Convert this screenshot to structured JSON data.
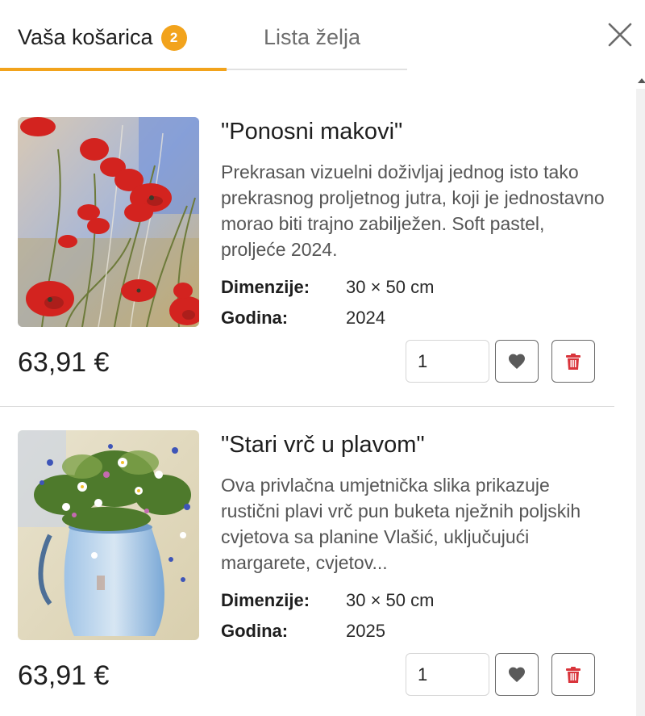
{
  "tabs": {
    "cart_label": "Vaša košarica",
    "cart_count": "2",
    "wishlist_label": "Lista želja"
  },
  "colors": {
    "accent": "#f2a31c",
    "trash": "#d9343b"
  },
  "icons": [
    "close-icon",
    "heart-icon",
    "trash-icon"
  ],
  "labels": {
    "dimensions": "Dimenzije:",
    "year": "Godina:"
  },
  "items": [
    {
      "title": "\"Ponosni makovi\"",
      "description": "Prekrasan vizuelni doživljaj jednog isto tako prekrasnog proljetnog jutra, koji je jednostavno morao biti trajno zabilježen. Soft pastel, proljeće 2024.",
      "dimensions": "30 × 50 cm",
      "year": "2024",
      "price": "63,91 €",
      "quantity": "1"
    },
    {
      "title": "\"Stari vrč u plavom\"",
      "description": "Ova privlačna umjetnička slika prikazuje rustični plavi vrč pun buketa nježnih poljskih cvjetova sa planine Vlašić, uključujući margarete, cvjetov...",
      "dimensions": "30 × 50 cm",
      "year": "2025",
      "price": "63,91 €",
      "quantity": "1"
    }
  ]
}
